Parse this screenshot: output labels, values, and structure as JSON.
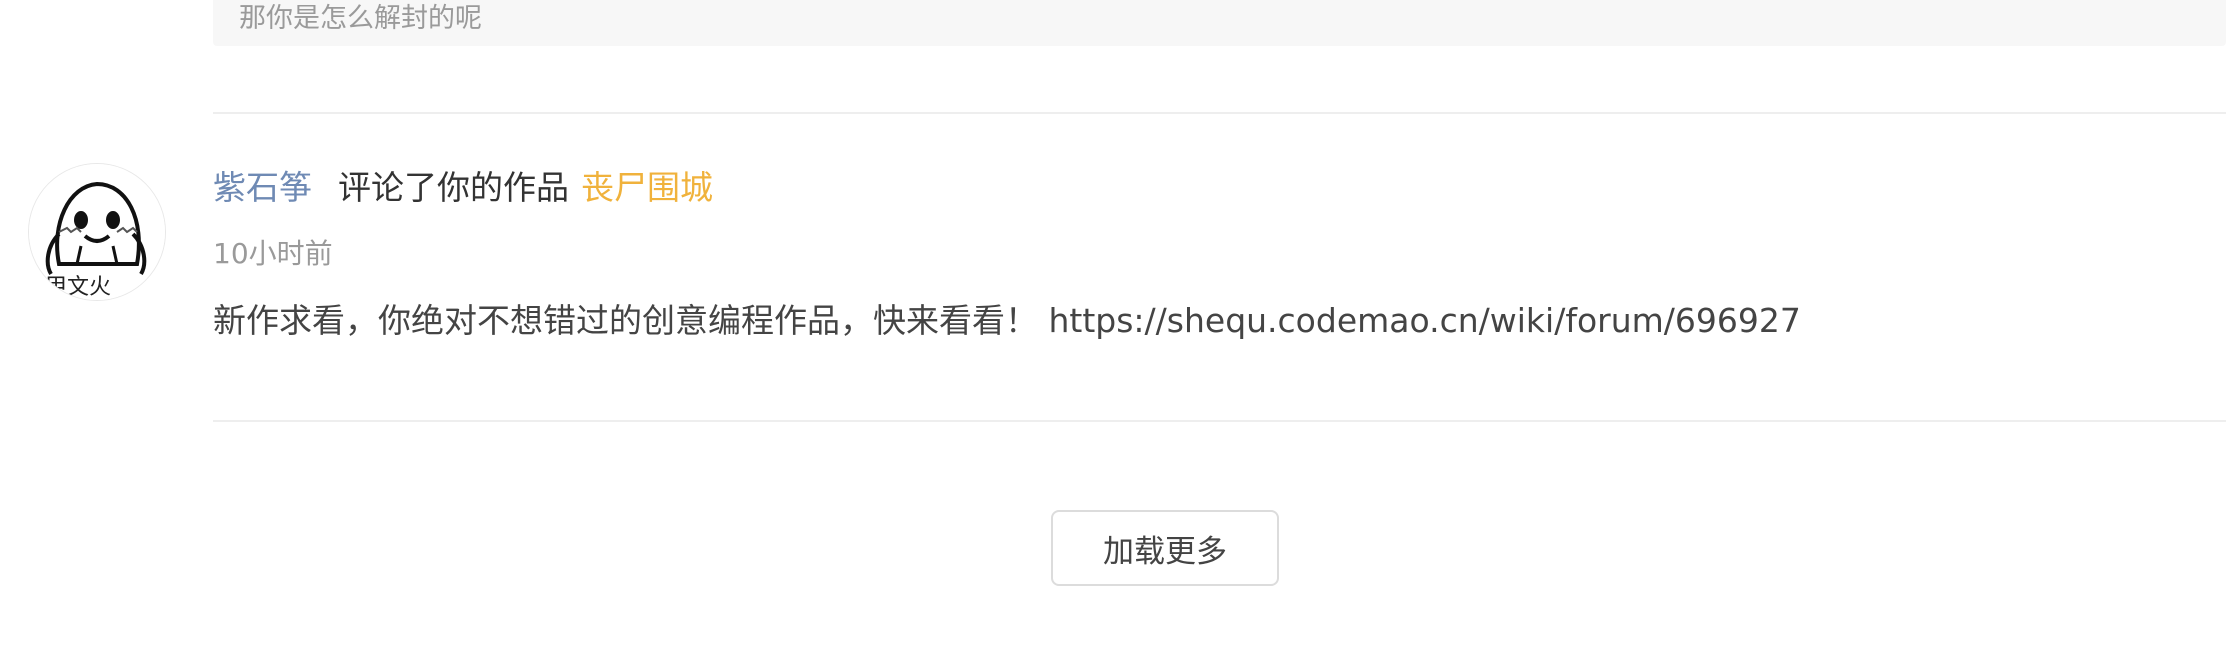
{
  "previous_reply": {
    "text": "那你是怎么解封的呢"
  },
  "notification": {
    "username": "紫石筝",
    "action": "评论了你的作品",
    "work_title": "丧尸围城",
    "time": "10小时前",
    "comment": "新作求看，你绝对不想错过的创意编程作品，快来看看！ https://shequ.codemao.cn/wiki/forum/696927",
    "avatar_caption": "甲文火",
    "avatar_icon": "meme-face-avatar"
  },
  "load_more": {
    "label": "加载更多"
  },
  "colors": {
    "username": "#6f8ab4",
    "work_link": "#f0b23c",
    "muted": "#9a9a9a"
  }
}
